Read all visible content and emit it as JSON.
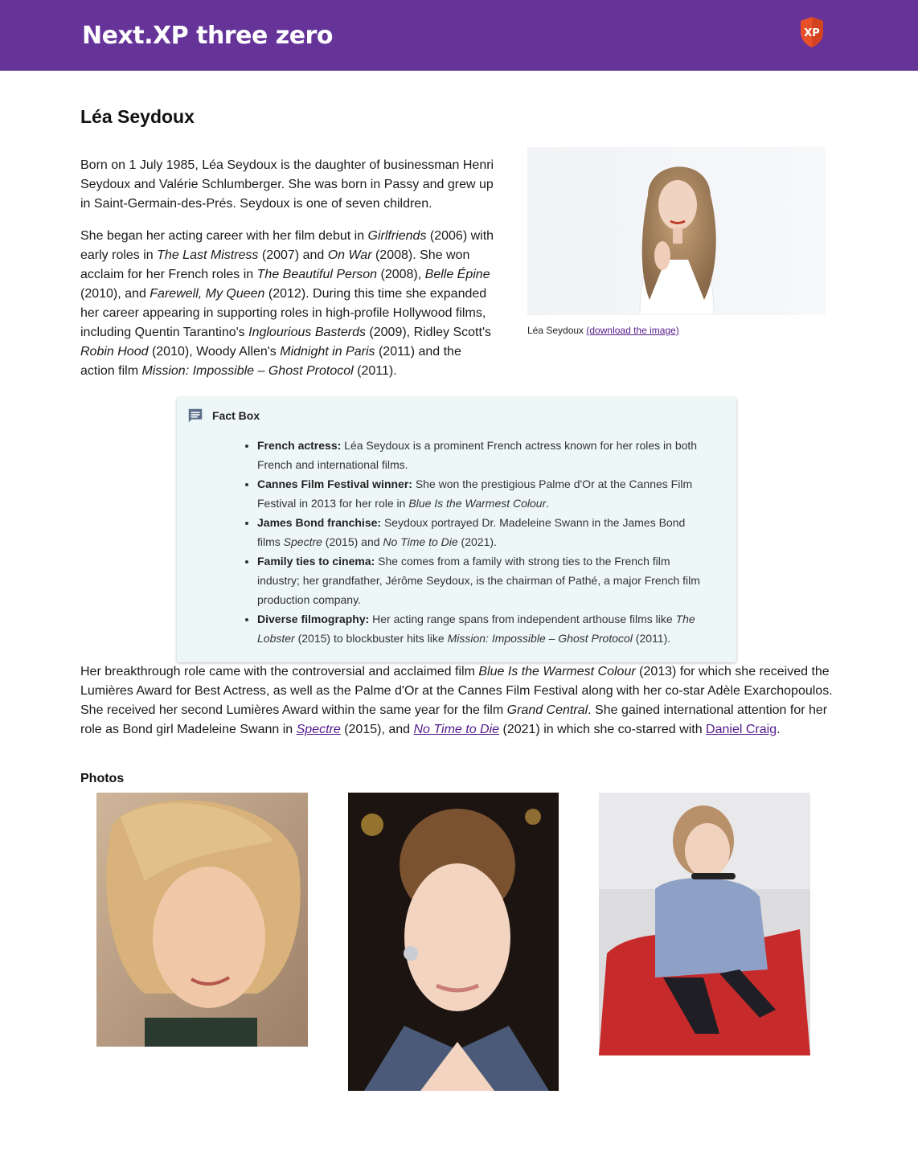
{
  "header": {
    "site_title": "Next.XP three zero",
    "logo_text": "XP",
    "brand_color": "#663399",
    "logo_color": "#e8502a"
  },
  "article": {
    "title": "Léa Seydoux",
    "figure": {
      "caption_name": "Léa Seydoux ",
      "download_link": "(download the image)"
    },
    "intro_p1": "Born on 1 July 1985, Léa Seydoux is the daughter of businessman Henri Seydoux and Valérie Schlumberger. She was born in Passy and grew up in Saint-Germain-des-Prés. Seydoux is one of seven children.",
    "p2": {
      "t1": "She began her acting career with her film debut in ",
      "girlfriends": "Girlfriends",
      "t2": " (2006) with early roles in ",
      "last_mistress": "The Last Mistress",
      "t3": " (2007) and ",
      "on_war": "On War",
      "t4": " (2008). She won acclaim for her French roles in ",
      "beautiful_person": "The Beautiful Person",
      "t5": " (2008), ",
      "belle_epine": "Belle Épine",
      "t6": " (2010), and ",
      "farewell": "Farewell, My Queen",
      "t7": " (2012). During this time she expanded her career appearing in supporting roles in high-profile Hollywood films, including Quentin Tarantino's ",
      "basterds": "Inglourious Basterds",
      "t8": " (2009), Ridley Scott's ",
      "robin_hood": "Robin Hood",
      "t9": " (2010), Woody Allen's ",
      "midnight": "Midnight in Paris",
      "t10": " (2011) and the action film ",
      "mission": "Mission: Impossible – Ghost Protocol",
      "t11": " (2011)."
    },
    "factbox": {
      "title": "Fact Box",
      "items": [
        {
          "label": "French actress:",
          "text": " Léa Seydoux is a prominent French actress known for her roles in both French and international films."
        },
        {
          "label": "Cannes Film Festival winner:",
          "text": " She won the prestigious Palme d'Or at the Cannes Film Festival in 2013 for her role in ",
          "em": "Blue Is the Warmest Colour",
          "tail": "."
        },
        {
          "label": "James Bond franchise:",
          "text": " Seydoux portrayed Dr. Madeleine Swann in the James Bond films ",
          "em": "Spectre",
          "mid": " (2015) and ",
          "em2": "No Time to Die",
          "tail": " (2021)."
        },
        {
          "label": "Family ties to cinema:",
          "text": " She comes from a family with strong ties to the French film industry; her grandfather, Jérôme Seydoux, is the chairman of Pathé, a major French film production company."
        },
        {
          "label": "Diverse filmography:",
          "text": " Her acting range spans from independent arthouse films like ",
          "em": "The Lobster",
          "mid": " (2015) to blockbuster hits like ",
          "em2": "Mission: Impossible – Ghost Protocol",
          "tail": " (2011)."
        }
      ]
    },
    "p3": {
      "t1": "Her breakthrough role came with the controversial and acclaimed film ",
      "blue": "Blue Is the Warmest Colour",
      "t2": " (2013) for which she received the Lumières Award for Best Actress, as well as the Palme d'Or at the Cannes Film Festival along with her co-star Adèle Exarchopoulos. She received her second Lumières Award within the same year for the film ",
      "grand_central": "Grand Central",
      "t3": ". She gained international attention for her role as Bond girl Madeleine Swann in ",
      "spectre_link": "Spectre",
      "t4": " (2015), and ",
      "no_time_link": "No Time to Die",
      "t5": " (2021) in which she co-starred with ",
      "craig_link": "Daniel Craig",
      "t6": "."
    },
    "photos_heading": "Photos"
  }
}
